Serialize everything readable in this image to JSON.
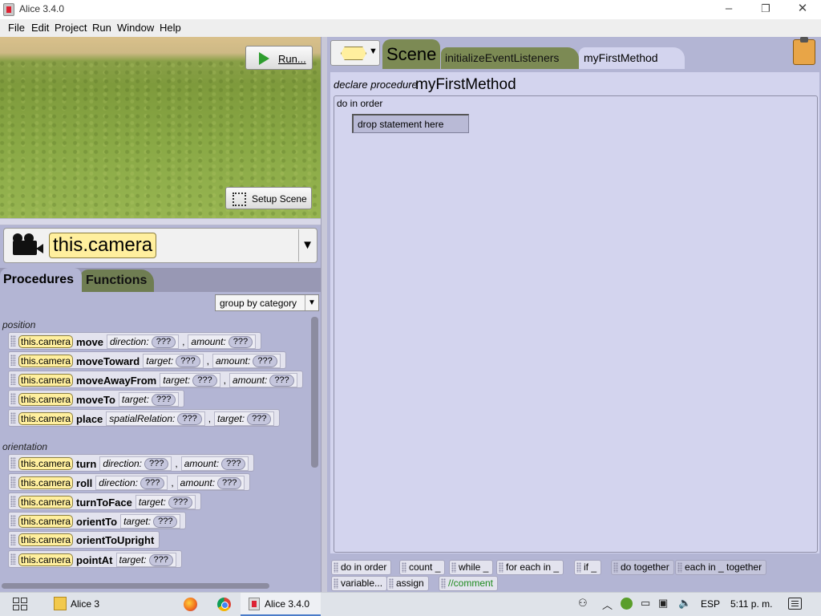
{
  "window": {
    "title": "Alice 3.4.0"
  },
  "menubar": {
    "items": [
      "File",
      "Edit",
      "Project",
      "Run",
      "Window",
      "Help"
    ]
  },
  "scene_view": {
    "run_label": "Run...",
    "setup_label": "Setup Scene"
  },
  "selector": {
    "value": "this.camera"
  },
  "left_tabs": {
    "procedures": "Procedures",
    "functions": "Functions"
  },
  "group_select": {
    "value": "group by category"
  },
  "categories": {
    "position": "position",
    "orientation": "orientation"
  },
  "tile_common": {
    "target": "this.camera",
    "placeholder": "???",
    "comma": ","
  },
  "procedures": [
    {
      "name": "move",
      "params": [
        "direction:",
        "amount:"
      ]
    },
    {
      "name": "moveToward",
      "params": [
        "target:",
        "amount:"
      ]
    },
    {
      "name": "moveAwayFrom",
      "params": [
        "target:",
        "amount:"
      ]
    },
    {
      "name": "moveTo",
      "params": [
        "target:"
      ]
    },
    {
      "name": "place",
      "params": [
        "spatialRelation:",
        "target:"
      ]
    },
    {
      "name": "turn",
      "params": [
        "direction:",
        "amount:"
      ]
    },
    {
      "name": "roll",
      "params": [
        "direction:",
        "amount:"
      ]
    },
    {
      "name": "turnToFace",
      "params": [
        "target:"
      ]
    },
    {
      "name": "orientTo",
      "params": [
        "target:"
      ]
    },
    {
      "name": "orientToUpright",
      "params": []
    },
    {
      "name": "pointAt",
      "params": [
        "target:"
      ]
    }
  ],
  "editor_tabs": {
    "scene": "Scene",
    "init": "initializeEventListeners",
    "method": "myFirstMethod"
  },
  "editor": {
    "declare": "declare procedure",
    "method_name": "myFirstMethod",
    "do_in_order": "do in order",
    "drop_here": "drop statement here"
  },
  "controls": {
    "do_in_order": "do in order",
    "count": "count _",
    "while": "while _",
    "for_each_in": "for each in _",
    "if": "if _",
    "do_together": "do together",
    "each_in_together": "each in _ together",
    "variable": "variable...",
    "assign": "assign",
    "comment": "//comment"
  },
  "taskbar": {
    "alice3": "Alice 3",
    "alice340": "Alice 3.4.0",
    "lang": "ESP",
    "time": "5:11 p. m."
  },
  "colors": {
    "panel": "#b3b5d4",
    "editor": "#d3d4ee",
    "chip": "#ffef9e",
    "scene_tab": "#7c8a54",
    "functions_tab": "#6f7d52",
    "comment": "#1d8a1d"
  }
}
